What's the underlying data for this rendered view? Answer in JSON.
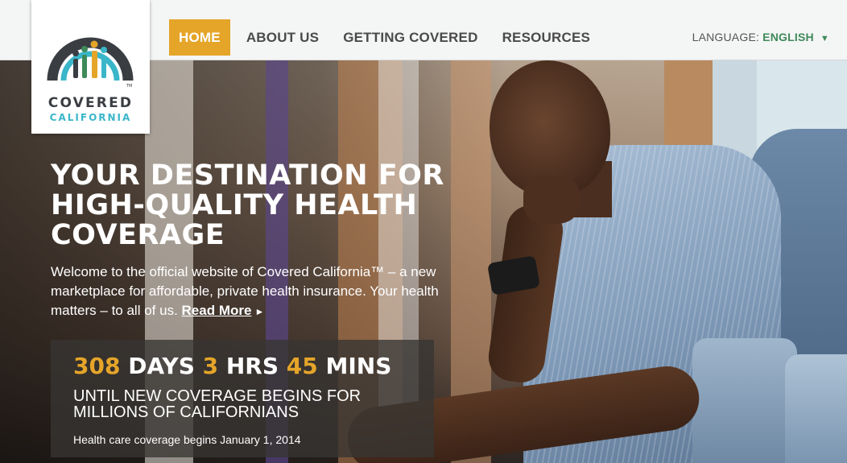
{
  "brand": {
    "logo_line1": "COVERED",
    "logo_line2": "CALIFORNIA",
    "logo_mark": "TM",
    "colors": {
      "accent_gold": "#e5a529",
      "teal": "#3ab6c9",
      "green": "#3f8a5a",
      "dark_gray": "#3a3d42"
    }
  },
  "nav": {
    "items": [
      {
        "label": "HOME",
        "active": true
      },
      {
        "label": "ABOUT US",
        "active": false
      },
      {
        "label": "GETTING COVERED",
        "active": false
      },
      {
        "label": "RESOURCES",
        "active": false
      }
    ]
  },
  "language": {
    "label": "LANGUAGE:",
    "value": "ENGLISH",
    "icon": "caret-down-icon"
  },
  "hero": {
    "headline": "YOUR DESTINATION FOR HIGH-QUALITY HEALTH COVERAGE",
    "welcome_text": "Welcome to the official website of Covered California™ – a new marketplace for affordable, private health insurance. Your health matters – to all of us.",
    "read_more": "Read More",
    "read_more_icon": "arrow-right-icon"
  },
  "countdown": {
    "days_value": "308",
    "days_label": "DAYS",
    "hours_value": "3",
    "hours_label": "HRS",
    "mins_value": "45",
    "mins_label": "MINS",
    "subtitle": "UNTIL NEW COVERAGE BEGINS FOR MILLIONS OF CALIFORNIANS",
    "footnote": "Health care coverage begins January 1, 2014"
  }
}
